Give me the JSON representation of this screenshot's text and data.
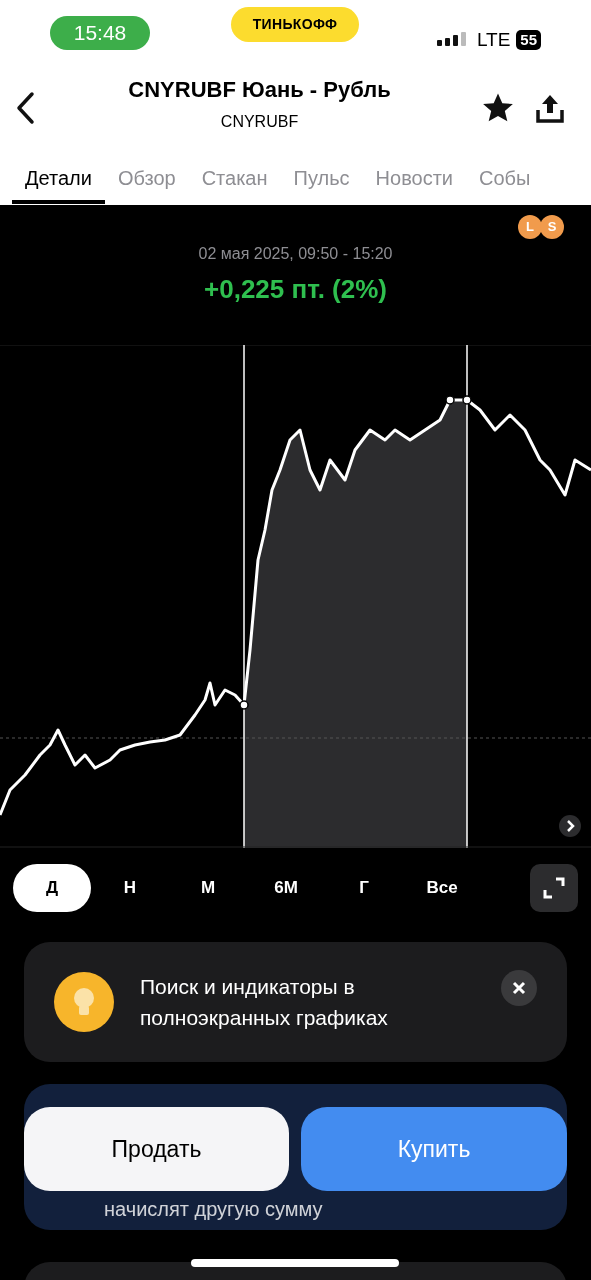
{
  "status_bar": {
    "time": "15:48",
    "carrier_badge": "ТИНЬКОФФ",
    "network": "LTE",
    "battery": "55"
  },
  "header": {
    "title": "CNYRUBF Юань - Рубль",
    "subtitle": "CNYRUBF"
  },
  "tabs": [
    {
      "label": "Детали",
      "selected": true
    },
    {
      "label": "Обзор",
      "selected": false
    },
    {
      "label": "Стакан",
      "selected": false
    },
    {
      "label": "Пульс",
      "selected": false
    },
    {
      "label": "Новости",
      "selected": false
    },
    {
      "label": "Собы",
      "selected": false
    }
  ],
  "chart": {
    "badges": [
      "L",
      "S"
    ],
    "range": "02 мая 2025, 09:50 - 15:20",
    "change": "+0,225 пт. (2%)"
  },
  "periods": [
    {
      "label": "Д",
      "selected": true
    },
    {
      "label": "Н",
      "selected": false
    },
    {
      "label": "М",
      "selected": false
    },
    {
      "label": "6М",
      "selected": false
    },
    {
      "label": "Г",
      "selected": false
    },
    {
      "label": "Все",
      "selected": false
    }
  ],
  "tip": {
    "text": "Поиск и индикаторы в полноэкранных графиках"
  },
  "notice": {
    "text": "начислят другую сумму"
  },
  "actions": [
    {
      "label": "Продать",
      "kind": "sell"
    },
    {
      "label": "Купить",
      "kind": "buy"
    }
  ]
}
